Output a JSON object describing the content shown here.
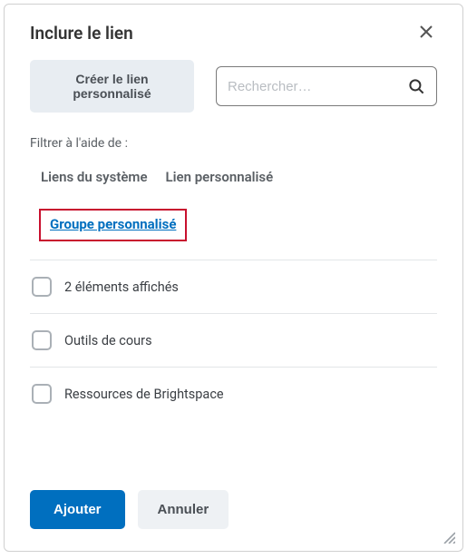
{
  "header": {
    "title": "Inclure le lien"
  },
  "toolbar": {
    "create_link_label": "Créer le lien personnalisé",
    "search_placeholder": "Rechercher…"
  },
  "filter": {
    "label": "Filtrer à l'aide de :",
    "tabs": {
      "system": "Liens du système",
      "custom_link": "Lien personnalisé",
      "custom_group": "Groupe personnalisé"
    }
  },
  "list": {
    "items": [
      {
        "label": "2 éléments affichés"
      },
      {
        "label": "Outils de cours"
      },
      {
        "label": "Ressources de Brightspace"
      }
    ]
  },
  "footer": {
    "add_label": "Ajouter",
    "cancel_label": "Annuler"
  }
}
